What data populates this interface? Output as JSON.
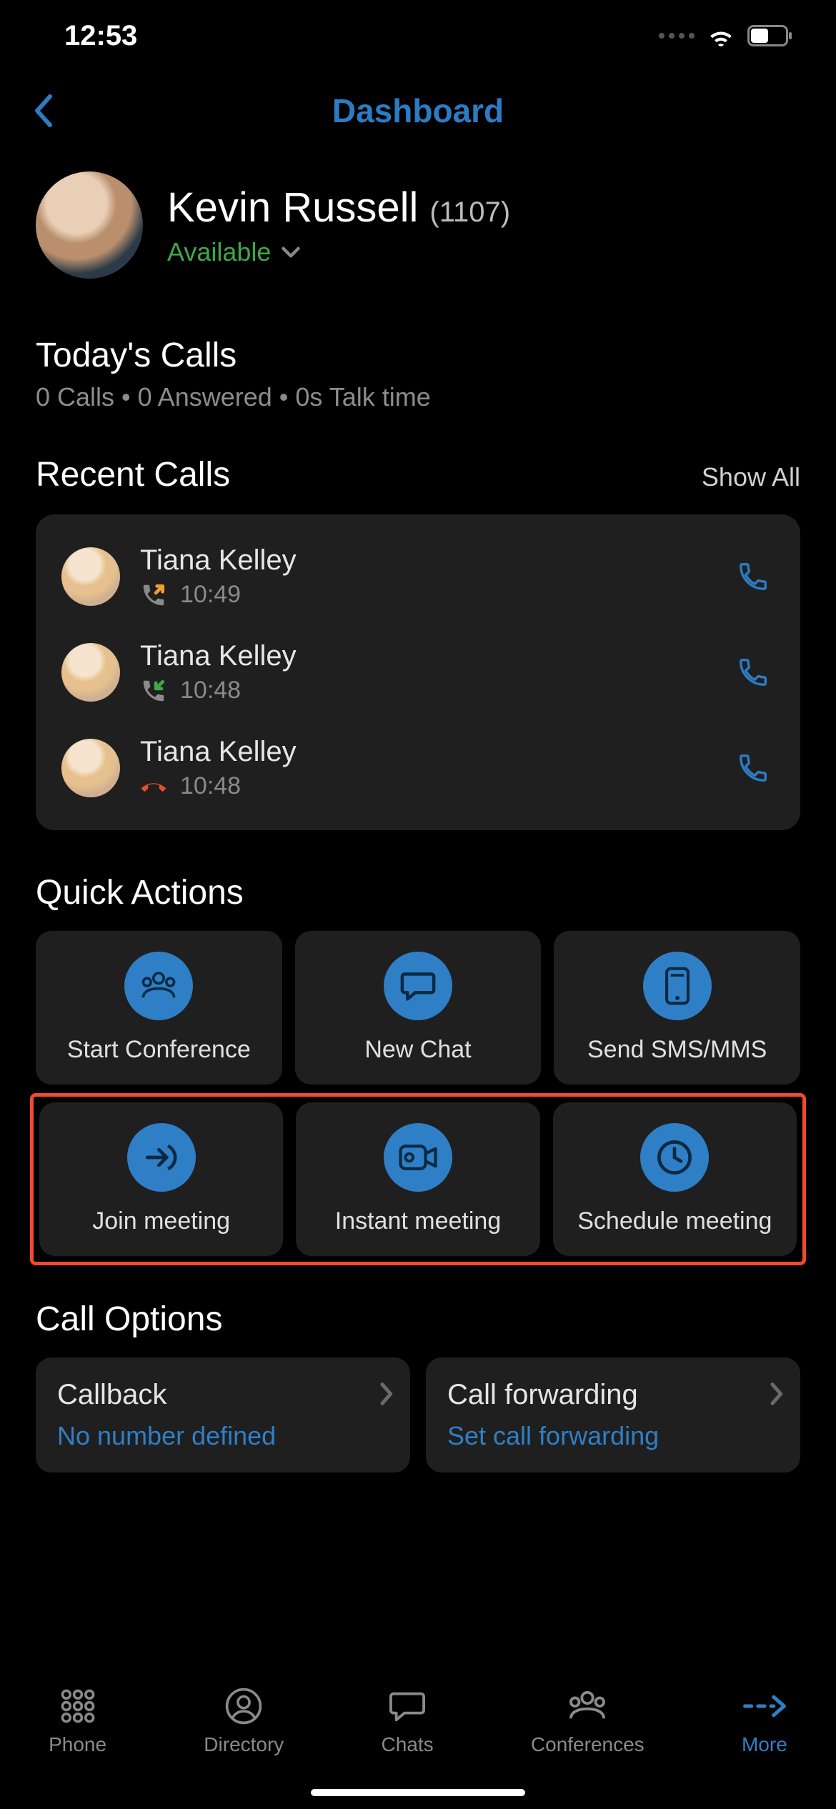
{
  "status_bar": {
    "time": "12:53"
  },
  "nav": {
    "title": "Dashboard"
  },
  "profile": {
    "name": "Kevin Russell",
    "ext": "(1107)",
    "status": "Available"
  },
  "today": {
    "title": "Today's Calls",
    "subtitle": "0 Calls  •  0 Answered  •  0s Talk time"
  },
  "recent": {
    "title": "Recent Calls",
    "show_all": "Show All",
    "items": [
      {
        "name": "Tiana Kelley",
        "time": "10:49",
        "type": "outgoing"
      },
      {
        "name": "Tiana Kelley",
        "time": "10:48",
        "type": "incoming"
      },
      {
        "name": "Tiana Kelley",
        "time": "10:48",
        "type": "missed"
      }
    ]
  },
  "quick_actions": {
    "title": "Quick Actions",
    "row1": [
      {
        "label": "Start Conference",
        "icon": "conference"
      },
      {
        "label": "New Chat",
        "icon": "chat"
      },
      {
        "label": "Send SMS/MMS",
        "icon": "sms"
      }
    ],
    "row2": [
      {
        "label": "Join meeting",
        "icon": "join"
      },
      {
        "label": "Instant meeting",
        "icon": "video"
      },
      {
        "label": "Schedule meeting",
        "icon": "clock"
      }
    ]
  },
  "call_options": {
    "title": "Call Options",
    "items": [
      {
        "title": "Callback",
        "subtitle": "No number defined"
      },
      {
        "title": "Call forwarding",
        "subtitle": "Set call forwarding"
      }
    ]
  },
  "tabs": {
    "items": [
      {
        "label": "Phone",
        "icon": "keypad"
      },
      {
        "label": "Directory",
        "icon": "contact"
      },
      {
        "label": "Chats",
        "icon": "chat"
      },
      {
        "label": "Conferences",
        "icon": "conference"
      },
      {
        "label": "More",
        "icon": "more",
        "active": true
      }
    ]
  }
}
